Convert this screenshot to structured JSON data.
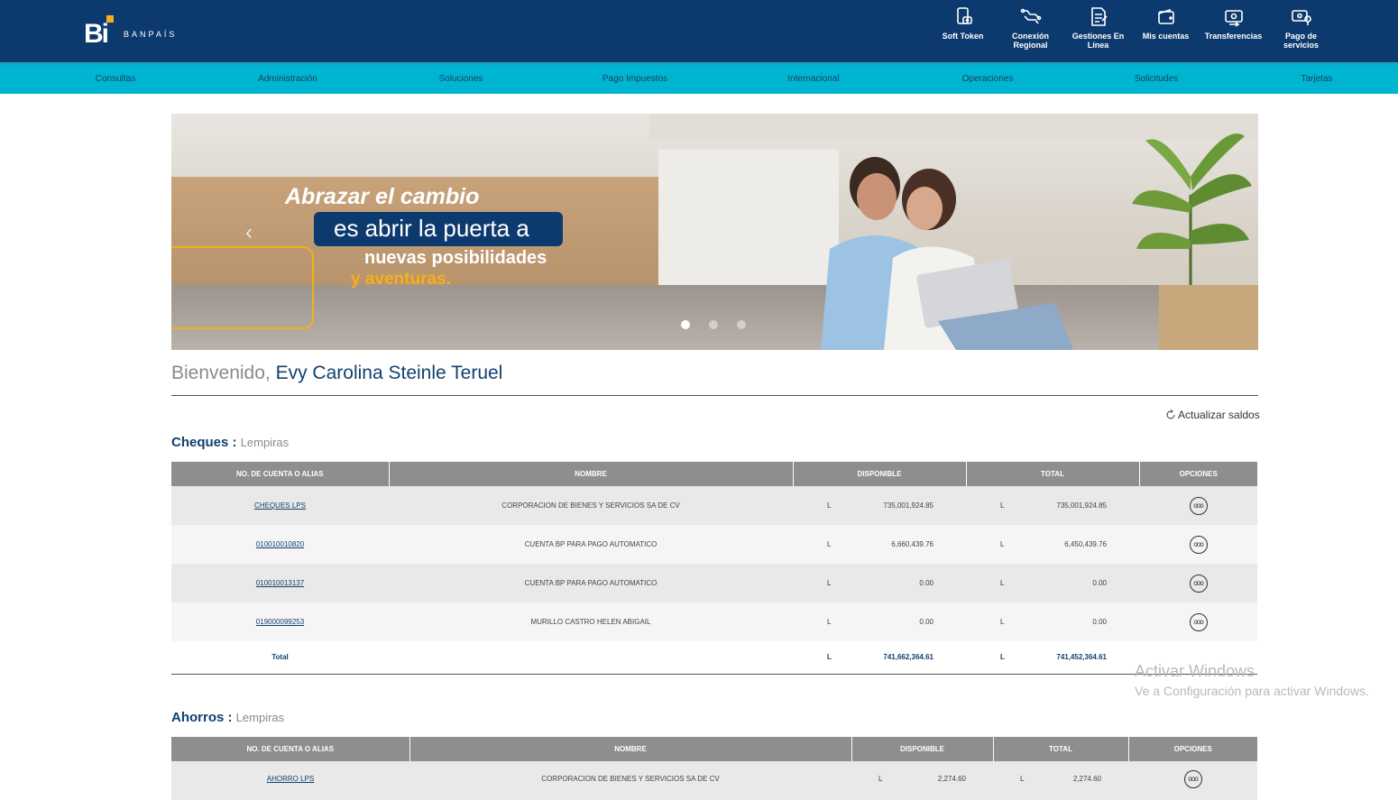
{
  "header": {
    "logo_text": "BANPAÍS",
    "actions": [
      {
        "label": "Soft Token",
        "icon": "soft-token-icon"
      },
      {
        "label": "Conexión Regional",
        "icon": "regional-connection-icon"
      },
      {
        "label": "Gestiones En Línea",
        "icon": "online-management-icon"
      },
      {
        "label": "Mis cuentas",
        "icon": "wallet-icon"
      },
      {
        "label": "Transferencias",
        "icon": "transfer-icon"
      },
      {
        "label": "Pago de servicios",
        "icon": "service-payment-icon"
      }
    ]
  },
  "nav": {
    "items": [
      "Consultas",
      "Administración",
      "Soluciones",
      "Pago Impuestos",
      "Internacional",
      "Operaciones",
      "Solicitudes",
      "Tarjetas"
    ]
  },
  "banner": {
    "line1": "Abrazar el cambio",
    "line2": "es abrir la puerta a",
    "line3": "nuevas posibilidades",
    "line4": "y aventuras.",
    "prev_glyph": "‹",
    "slide_count": 3,
    "active_slide": 1
  },
  "welcome": {
    "greeting": "Bienvenido,",
    "name": "Evy Carolina Steinle Teruel",
    "refresh_label": "Actualizar saldos"
  },
  "cheques": {
    "title": "Cheques :",
    "currency": "Lempiras",
    "columns": [
      "NO. DE CUENTA O ALIAS",
      "NOMBRE",
      "DISPONIBLE",
      "TOTAL",
      "OPCIONES"
    ],
    "rows": [
      {
        "account": "CHEQUES LPS",
        "name": "CORPORACION DE BIENES Y SERVICIOS SA DE CV",
        "cur1": "L",
        "available": "735,001,924.85",
        "cur2": "L",
        "total": "735,001,924.85"
      },
      {
        "account": "010010010820",
        "name": "CUENTA BP PARA PAGO AUTOMATICO",
        "cur1": "L",
        "available": "6,660,439.76",
        "cur2": "L",
        "total": "6,450,439.76"
      },
      {
        "account": "010010013137",
        "name": "CUENTA BP PARA PAGO AUTOMATICO",
        "cur1": "L",
        "available": "0.00",
        "cur2": "L",
        "total": "0.00"
      },
      {
        "account": "019000099253",
        "name": "MURILLO CASTRO HELEN ABIGAIL",
        "cur1": "L",
        "available": "0.00",
        "cur2": "L",
        "total": "0.00"
      }
    ],
    "total": {
      "label": "Total",
      "cur1": "L",
      "available": "741,662,364.61",
      "cur2": "L",
      "total": "741,452,364.61"
    }
  },
  "ahorros": {
    "title": "Ahorros :",
    "currency": "Lempiras",
    "columns": [
      "NO. DE CUENTA O ALIAS",
      "NOMBRE",
      "DISPONIBLE",
      "TOTAL",
      "OPCIONES"
    ],
    "rows": [
      {
        "account": "AHORRO LPS",
        "name": "CORPORACION DE BIENES Y SERVICIOS SA DE CV",
        "cur1": "L",
        "available": "2,274.60",
        "cur2": "L",
        "total": "2,274.60"
      }
    ]
  },
  "options_glyph": "ooo",
  "watermark": {
    "line1": "Activar Windows",
    "line2": "Ve a Configuración para activar Windows."
  },
  "colors": {
    "header_bg": "#0d3a6e",
    "nav_bg": "#00b5d1",
    "accent": "#f4b01c",
    "table_header": "#8e8e8e"
  }
}
